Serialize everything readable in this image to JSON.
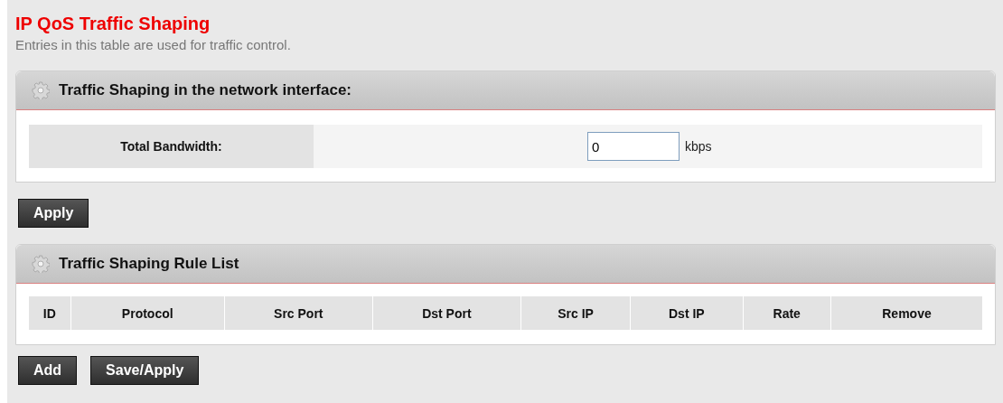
{
  "page": {
    "title": "IP QoS Traffic Shaping",
    "description": "Entries in this table are used for traffic control."
  },
  "bandwidth_panel": {
    "title": "Traffic Shaping in the network interface:",
    "field_label": "Total Bandwidth:",
    "value": "0",
    "unit": "kbps"
  },
  "apply_button": "Apply",
  "rules_panel": {
    "title": "Traffic Shaping Rule List",
    "columns": [
      "ID",
      "Protocol",
      "Src Port",
      "Dst Port",
      "Src IP",
      "Dst IP",
      "Rate",
      "Remove"
    ]
  },
  "buttons": [
    "Add",
    "Save/Apply"
  ]
}
